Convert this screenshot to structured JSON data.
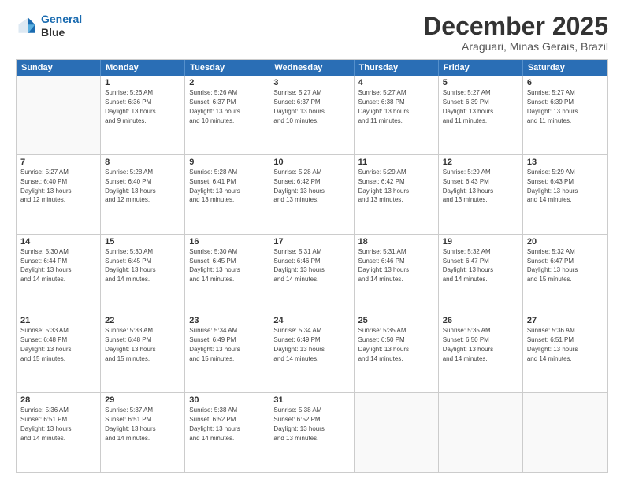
{
  "header": {
    "logo_line1": "General",
    "logo_line2": "Blue",
    "main_title": "December 2025",
    "subtitle": "Araguari, Minas Gerais, Brazil"
  },
  "days_of_week": [
    "Sunday",
    "Monday",
    "Tuesday",
    "Wednesday",
    "Thursday",
    "Friday",
    "Saturday"
  ],
  "weeks": [
    [
      {
        "day": "",
        "text": ""
      },
      {
        "day": "1",
        "text": "Sunrise: 5:26 AM\nSunset: 6:36 PM\nDaylight: 13 hours\nand 9 minutes."
      },
      {
        "day": "2",
        "text": "Sunrise: 5:26 AM\nSunset: 6:37 PM\nDaylight: 13 hours\nand 10 minutes."
      },
      {
        "day": "3",
        "text": "Sunrise: 5:27 AM\nSunset: 6:37 PM\nDaylight: 13 hours\nand 10 minutes."
      },
      {
        "day": "4",
        "text": "Sunrise: 5:27 AM\nSunset: 6:38 PM\nDaylight: 13 hours\nand 11 minutes."
      },
      {
        "day": "5",
        "text": "Sunrise: 5:27 AM\nSunset: 6:39 PM\nDaylight: 13 hours\nand 11 minutes."
      },
      {
        "day": "6",
        "text": "Sunrise: 5:27 AM\nSunset: 6:39 PM\nDaylight: 13 hours\nand 11 minutes."
      }
    ],
    [
      {
        "day": "7",
        "text": "Sunrise: 5:27 AM\nSunset: 6:40 PM\nDaylight: 13 hours\nand 12 minutes."
      },
      {
        "day": "8",
        "text": "Sunrise: 5:28 AM\nSunset: 6:40 PM\nDaylight: 13 hours\nand 12 minutes."
      },
      {
        "day": "9",
        "text": "Sunrise: 5:28 AM\nSunset: 6:41 PM\nDaylight: 13 hours\nand 13 minutes."
      },
      {
        "day": "10",
        "text": "Sunrise: 5:28 AM\nSunset: 6:42 PM\nDaylight: 13 hours\nand 13 minutes."
      },
      {
        "day": "11",
        "text": "Sunrise: 5:29 AM\nSunset: 6:42 PM\nDaylight: 13 hours\nand 13 minutes."
      },
      {
        "day": "12",
        "text": "Sunrise: 5:29 AM\nSunset: 6:43 PM\nDaylight: 13 hours\nand 13 minutes."
      },
      {
        "day": "13",
        "text": "Sunrise: 5:29 AM\nSunset: 6:43 PM\nDaylight: 13 hours\nand 14 minutes."
      }
    ],
    [
      {
        "day": "14",
        "text": "Sunrise: 5:30 AM\nSunset: 6:44 PM\nDaylight: 13 hours\nand 14 minutes."
      },
      {
        "day": "15",
        "text": "Sunrise: 5:30 AM\nSunset: 6:45 PM\nDaylight: 13 hours\nand 14 minutes."
      },
      {
        "day": "16",
        "text": "Sunrise: 5:30 AM\nSunset: 6:45 PM\nDaylight: 13 hours\nand 14 minutes."
      },
      {
        "day": "17",
        "text": "Sunrise: 5:31 AM\nSunset: 6:46 PM\nDaylight: 13 hours\nand 14 minutes."
      },
      {
        "day": "18",
        "text": "Sunrise: 5:31 AM\nSunset: 6:46 PM\nDaylight: 13 hours\nand 14 minutes."
      },
      {
        "day": "19",
        "text": "Sunrise: 5:32 AM\nSunset: 6:47 PM\nDaylight: 13 hours\nand 14 minutes."
      },
      {
        "day": "20",
        "text": "Sunrise: 5:32 AM\nSunset: 6:47 PM\nDaylight: 13 hours\nand 15 minutes."
      }
    ],
    [
      {
        "day": "21",
        "text": "Sunrise: 5:33 AM\nSunset: 6:48 PM\nDaylight: 13 hours\nand 15 minutes."
      },
      {
        "day": "22",
        "text": "Sunrise: 5:33 AM\nSunset: 6:48 PM\nDaylight: 13 hours\nand 15 minutes."
      },
      {
        "day": "23",
        "text": "Sunrise: 5:34 AM\nSunset: 6:49 PM\nDaylight: 13 hours\nand 15 minutes."
      },
      {
        "day": "24",
        "text": "Sunrise: 5:34 AM\nSunset: 6:49 PM\nDaylight: 13 hours\nand 14 minutes."
      },
      {
        "day": "25",
        "text": "Sunrise: 5:35 AM\nSunset: 6:50 PM\nDaylight: 13 hours\nand 14 minutes."
      },
      {
        "day": "26",
        "text": "Sunrise: 5:35 AM\nSunset: 6:50 PM\nDaylight: 13 hours\nand 14 minutes."
      },
      {
        "day": "27",
        "text": "Sunrise: 5:36 AM\nSunset: 6:51 PM\nDaylight: 13 hours\nand 14 minutes."
      }
    ],
    [
      {
        "day": "28",
        "text": "Sunrise: 5:36 AM\nSunset: 6:51 PM\nDaylight: 13 hours\nand 14 minutes."
      },
      {
        "day": "29",
        "text": "Sunrise: 5:37 AM\nSunset: 6:51 PM\nDaylight: 13 hours\nand 14 minutes."
      },
      {
        "day": "30",
        "text": "Sunrise: 5:38 AM\nSunset: 6:52 PM\nDaylight: 13 hours\nand 14 minutes."
      },
      {
        "day": "31",
        "text": "Sunrise: 5:38 AM\nSunset: 6:52 PM\nDaylight: 13 hours\nand 13 minutes."
      },
      {
        "day": "",
        "text": ""
      },
      {
        "day": "",
        "text": ""
      },
      {
        "day": "",
        "text": ""
      }
    ]
  ]
}
